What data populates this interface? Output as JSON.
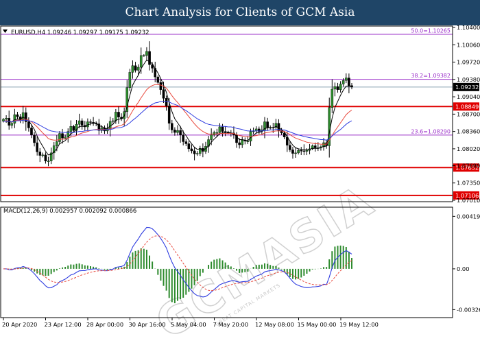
{
  "banner": {
    "title": "Chart Analysis for Clients of GCM Asia"
  },
  "watermark": {
    "text": "GCMASIA",
    "sub": "GREAT CAPITAL MARKETS"
  },
  "chart_data": {
    "type": "candlestick",
    "symbol_info": "EURUSD,H4  1.09246 1.09297 1.09175 1.09232",
    "price_axis": {
      "ylim": [
        1.0701,
        1.104
      ],
      "ticks": [
        "1.10400",
        "1.10060",
        "1.09720",
        "1.09380",
        "1.09040",
        "1.08700",
        "1.08360",
        "1.08020",
        "1.07690",
        "1.07350",
        "1.07010"
      ],
      "tick_values": [
        1.104,
        1.1006,
        1.0972,
        1.0938,
        1.0904,
        1.087,
        1.0836,
        1.0802,
        1.0769,
        1.0735,
        1.0701
      ]
    },
    "current_price": {
      "label": "1.09232",
      "value": 1.09232,
      "color": "#000000"
    },
    "fib_levels": [
      {
        "label": "50.0=1.10265",
        "value": 1.10265
      },
      {
        "label": "38.2=1.09382",
        "value": 1.09382
      },
      {
        "label": "23.6=1.08290",
        "value": 1.0829
      }
    ],
    "sr_levels": [
      {
        "label": "1.08849",
        "value": 1.08849
      },
      {
        "label": "1.07652",
        "value": 1.07652
      },
      {
        "label": "1.07106",
        "value": 1.07106
      }
    ],
    "x_labels": [
      "20 Apr 2020",
      "23 Apr 12:00",
      "28 Apr 00:00",
      "30 Apr 16:00",
      "5 May 04:00",
      "7 May 20:00",
      "12 May 08:00",
      "15 May 00:00",
      "19 May 12:00"
    ],
    "close_prices": [
      1.086,
      1.0862,
      1.0848,
      1.0852,
      1.0869,
      1.0865,
      1.0859,
      1.0873,
      1.0855,
      1.0843,
      1.0829,
      1.0814,
      1.0796,
      1.0789,
      1.079,
      1.0778,
      1.0778,
      1.0794,
      1.0808,
      1.0816,
      1.0832,
      1.0823,
      1.0825,
      1.0836,
      1.0846,
      1.0838,
      1.085,
      1.0857,
      1.0848,
      1.0845,
      1.0855,
      1.0854,
      1.0853,
      1.0851,
      1.0838,
      1.0843,
      1.0837,
      1.0842,
      1.0856,
      1.0857,
      1.0874,
      1.0864,
      1.0861,
      1.0875,
      1.0922,
      1.0952,
      1.0965,
      1.0956,
      1.0962,
      1.0985,
      1.0985,
      1.0993,
      1.0967,
      1.096,
      1.0943,
      1.0932,
      1.0918,
      1.0901,
      1.0886,
      1.0852,
      1.0839,
      1.0834,
      1.0838,
      1.0829,
      1.0816,
      1.0812,
      1.0802,
      1.0798,
      1.0792,
      1.0793,
      1.0803,
      1.0797,
      1.0807,
      1.082,
      1.0829,
      1.0834,
      1.0834,
      1.0845,
      1.0836,
      1.0835,
      1.0833,
      1.0833,
      1.0829,
      1.0814,
      1.081,
      1.0819,
      1.0817,
      1.0817,
      1.0836,
      1.0837,
      1.0841,
      1.0836,
      1.0839,
      1.0855,
      1.0844,
      1.0844,
      1.0844,
      1.0852,
      1.0838,
      1.0833,
      1.0825,
      1.0809,
      1.08,
      1.0793,
      1.0794,
      1.0799,
      1.0798,
      1.0797,
      1.0799,
      1.0802,
      1.0808,
      1.0804,
      1.0804,
      1.0806,
      1.0814,
      1.0808,
      1.0883,
      1.0919,
      1.0924,
      1.0918,
      1.0929,
      1.0936,
      1.0941,
      1.0926,
      1.0923
    ],
    "indicators": [
      {
        "name": "fast_ma",
        "color": "#000000",
        "values": [
          1.0856,
          1.0857,
          1.0854,
          1.0855,
          1.0859,
          1.086,
          1.086,
          1.0864,
          1.0861,
          1.0857,
          1.0849,
          1.084,
          1.0827,
          1.0816,
          1.0807,
          1.0797,
          1.079,
          1.0791,
          1.0796,
          1.0802,
          1.0812,
          1.0815,
          1.0818,
          1.0824,
          1.0832,
          1.0834,
          1.084,
          1.0846,
          1.0846,
          1.0846,
          1.0849,
          1.0851,
          1.0852,
          1.0852,
          1.0847,
          1.0846,
          1.0842,
          1.0842,
          1.0847,
          1.085,
          1.0858,
          1.086,
          1.0861,
          1.0866,
          1.0885,
          1.0907,
          1.0927,
          1.0937,
          1.0946,
          1.0959,
          1.0968,
          1.0976,
          1.0973,
          1.0969,
          1.096,
          1.0951,
          1.094,
          1.0927,
          1.0913,
          1.0893,
          1.0875,
          1.0861,
          1.0853,
          1.0845,
          1.0835,
          1.0828,
          1.0819,
          1.0812,
          1.0805,
          1.0801,
          1.0802,
          1.08,
          1.0802,
          1.0808,
          1.0815,
          1.0821,
          1.0826,
          1.0832,
          1.0833,
          1.0834,
          1.0834,
          1.0833,
          1.0832,
          1.0826,
          1.082,
          1.082,
          1.0819,
          1.0818,
          1.0824,
          1.0828,
          1.0833,
          1.0834,
          1.0836,
          1.0842,
          1.0843,
          1.0843,
          1.0843,
          1.0846,
          1.0843,
          1.084,
          1.0835,
          1.0826,
          1.0817,
          1.0809,
          1.0804,
          1.0802,
          1.0801,
          1.08,
          1.08,
          1.0801,
          1.0803,
          1.0803,
          1.0803,
          1.0804,
          1.0807,
          1.0807,
          1.0833,
          1.0862,
          1.0883,
          1.0895,
          1.0907,
          1.0917,
          1.0925,
          1.0925,
          1.0924
        ]
      },
      {
        "name": "mid_ma",
        "color": "#e8473b",
        "values": [
          1.0856,
          1.0857,
          1.0856,
          1.0855,
          1.0857,
          1.0858,
          1.0858,
          1.086,
          1.086,
          1.0858,
          1.0855,
          1.085,
          1.0845,
          1.0839,
          1.0833,
          1.0828,
          1.0822,
          1.082,
          1.0819,
          1.0819,
          1.082,
          1.0821,
          1.0821,
          1.0823,
          1.0825,
          1.0826,
          1.0828,
          1.0831,
          1.0833,
          1.0834,
          1.0836,
          1.0838,
          1.0839,
          1.084,
          1.084,
          1.084,
          1.084,
          1.084,
          1.0841,
          1.0843,
          1.0845,
          1.0847,
          1.0848,
          1.0851,
          1.0858,
          1.0867,
          1.0877,
          1.0885,
          1.0893,
          1.0902,
          1.091,
          1.0918,
          1.0923,
          1.0926,
          1.0928,
          1.0928,
          1.0927,
          1.0925,
          1.0921,
          1.0914,
          1.0906,
          1.0899,
          1.0893,
          1.0886,
          1.0879,
          1.0872,
          1.0865,
          1.0858,
          1.0851,
          1.0845,
          1.084,
          1.0836,
          1.0833,
          1.0831,
          1.0831,
          1.0831,
          1.0831,
          1.0832,
          1.0832,
          1.0832,
          1.0832,
          1.0832,
          1.0832,
          1.083,
          1.0828,
          1.0827,
          1.0826,
          1.0825,
          1.0826,
          1.0827,
          1.0828,
          1.0829,
          1.083,
          1.0833,
          1.0834,
          1.0835,
          1.0836,
          1.0837,
          1.0837,
          1.0837,
          1.0836,
          1.0833,
          1.083,
          1.0826,
          1.0823,
          1.0821,
          1.0819,
          1.0817,
          1.0815,
          1.0814,
          1.0813,
          1.0812,
          1.0812,
          1.0811,
          1.0811,
          1.0811,
          1.0818,
          1.0828,
          1.0837,
          1.0845,
          1.0853,
          1.0861,
          1.0869,
          1.0874,
          1.0878
        ]
      },
      {
        "name": "slow_ma",
        "color": "#2e3ce0",
        "values": [
          1.0856,
          1.0856,
          1.0856,
          1.0855,
          1.0856,
          1.0857,
          1.0857,
          1.0858,
          1.0858,
          1.0857,
          1.0856,
          1.0854,
          1.0851,
          1.0848,
          1.0845,
          1.0842,
          1.0839,
          1.0837,
          1.0836,
          1.0835,
          1.0835,
          1.0834,
          1.0834,
          1.0834,
          1.0834,
          1.0834,
          1.0835,
          1.0836,
          1.0836,
          1.0837,
          1.0838,
          1.0838,
          1.0839,
          1.0839,
          1.0839,
          1.0839,
          1.0839,
          1.084,
          1.084,
          1.0841,
          1.0843,
          1.0843,
          1.0844,
          1.0846,
          1.0849,
          1.0853,
          1.0858,
          1.0862,
          1.0867,
          1.0872,
          1.0877,
          1.0882,
          1.0886,
          1.0889,
          1.0892,
          1.0893,
          1.0895,
          1.0895,
          1.0895,
          1.0894,
          1.0891,
          1.0889,
          1.0887,
          1.0884,
          1.088,
          1.0877,
          1.0873,
          1.0869,
          1.0865,
          1.0861,
          1.0858,
          1.0855,
          1.0852,
          1.085,
          1.0849,
          1.0848,
          1.0847,
          1.0847,
          1.0846,
          1.0846,
          1.0845,
          1.0845,
          1.0844,
          1.0842,
          1.0841,
          1.084,
          1.0838,
          1.0837,
          1.0837,
          1.0837,
          1.0837,
          1.0837,
          1.0837,
          1.0838,
          1.0838,
          1.0839,
          1.0839,
          1.084,
          1.084,
          1.0839,
          1.0839,
          1.0837,
          1.0835,
          1.0833,
          1.0831,
          1.0829,
          1.0828,
          1.0826,
          1.0825,
          1.0824,
          1.0823,
          1.0822,
          1.0821,
          1.082,
          1.082,
          1.0819,
          1.0822,
          1.0827,
          1.0832,
          1.0836,
          1.084,
          1.0845,
          1.085,
          1.0854,
          1.0857
        ]
      }
    ],
    "macd": {
      "label": "MACD(12,26,9) 0.002957 0.002092 0.000866",
      "ticks": [
        "0.004197",
        "0.00",
        "-0.003262"
      ],
      "tick_values": [
        0.004197,
        0,
        -0.003262
      ],
      "ylim": [
        -0.00335,
        0.0046
      ],
      "histogram_color": "#2e8b2e",
      "signal_color": "#e8473b",
      "line_color": "#2e3ce0",
      "histogram": [
        0,
        1e-05,
        1e-05,
        1e-05,
        4e-05,
        6e-05,
        6e-05,
        0.0001,
        5e-05,
        -1e-05,
        -0.0001,
        -0.00022,
        -0.00037,
        -0.00048,
        -0.00052,
        -0.00057,
        -0.00055,
        -0.00041,
        -0.00025,
        -0.00013,
        4e-05,
        0.00011,
        0.00016,
        0.00026,
        0.00035,
        0.00034,
        0.0004,
        0.00043,
        0.00036,
        0.00028,
        0.00026,
        0.00021,
        0.00017,
        0.00012,
        3e-05,
        -1e-05,
        -7e-05,
        -9e-05,
        -4e-05,
        -1e-05,
        9e-05,
        0.00011,
        0.00011,
        0.00017,
        0.00054,
        0.00097,
        0.00131,
        0.00143,
        0.00149,
        0.00164,
        0.0016,
        0.00153,
        0.00106,
        0.00058,
        2e-05,
        -0.00048,
        -0.00094,
        -0.00136,
        -0.00174,
        -0.00233,
        -0.00266,
        -0.00275,
        -0.00256,
        -0.00242,
        -0.00231,
        -0.00207,
        -0.00184,
        -0.00158,
        -0.00131,
        -0.00097,
        -0.00058,
        -0.00031,
        0,
        0.00032,
        0.00057,
        0.00073,
        0.00078,
        0.00084,
        0.00068,
        0.00051,
        0.00032,
        0.00019,
        4e-05,
        -0.00015,
        -0.00033,
        -0.0003,
        -0.00027,
        -0.00022,
        1e-05,
        0.00016,
        0.00031,
        0.00033,
        0.00034,
        0.00044,
        0.0004,
        0.00031,
        0.00023,
        0.00022,
        0.0001,
        -5e-05,
        -0.00023,
        -0.00046,
        -0.00066,
        -0.00081,
        -0.00085,
        -0.0008,
        -0.00069,
        -0.00055,
        -0.00039,
        -0.00021,
        -5e-05,
        -3e-05,
        -1e-05,
        3e-05,
        0.00014,
        0.00015,
        0.00076,
        0.00141,
        0.00178,
        0.00184,
        0.00186,
        0.00183,
        0.00175,
        0.00137,
        0.00087
      ],
      "macd_line": [
        0,
        0,
        -7e-05,
        -8e-05,
        3e-05,
        8e-05,
        0.0001,
        0.00019,
        0.00012,
        1e-05,
        -0.00017,
        -0.00039,
        -0.00066,
        -0.00093,
        -0.00112,
        -0.00136,
        -0.00152,
        -0.00151,
        -0.00139,
        -0.00127,
        -0.00103,
        -0.00093,
        -0.00082,
        -0.00066,
        -0.00048,
        -0.00042,
        -0.00028,
        -0.00016,
        -0.00014,
        -0.00014,
        -7e-05,
        -4e-05,
        -1e-05,
        0,
        -8e-05,
        -0.0001,
        -0.00015,
        -0.00015,
        -7e-05,
        -2e-05,
        0.00012,
        0.00016,
        0.00019,
        0.00028,
        0.00069,
        0.00123,
        0.00175,
        0.00208,
        0.00238,
        0.00276,
        0.00304,
        0.00331,
        0.0033,
        0.0032,
        0.00298,
        0.00273,
        0.00243,
        0.00208,
        0.00168,
        0.00107,
        0.00054,
        9e-05,
        -0.00021,
        -0.00052,
        -0.00087,
        -0.00117,
        -0.00148,
        -0.00175,
        -0.00199,
        -0.00214,
        -0.00218,
        -0.00225,
        -0.00221,
        -0.00206,
        -0.00185,
        -0.00165,
        -0.00147,
        -0.00127,
        -0.00118,
        -0.0011,
        -0.00103,
        -0.00097,
        -0.00094,
        -0.00101,
        -0.00107,
        -0.00103,
        -0.00101,
        -0.001,
        -0.00085,
        -0.00072,
        -0.00058,
        -0.0005,
        -0.00041,
        -0.00024,
        -0.00018,
        -0.00014,
        -0.0001,
        -4e-05,
        -8e-05,
        -0.00014,
        -0.00025,
        -0.00047,
        -0.00075,
        -0.00102,
        -0.00122,
        -0.00132,
        -0.00141,
        -0.00147,
        -0.0015,
        -0.00149,
        -0.00144,
        -0.00143,
        -0.00141,
        -0.00136,
        -0.00123,
        -0.00126,
        -0.00066,
        9e-05,
        0.00066,
        0.00092,
        0.00114,
        0.00132,
        0.00146,
        0.00133,
        0.00118
      ],
      "signal_line": [
        0,
        0,
        -1e-05,
        -3e-05,
        -1e-05,
        1e-05,
        3e-05,
        6e-05,
        8e-05,
        7e-05,
        2e-05,
        -7e-05,
        -0.00019,
        -0.00034,
        -0.0005,
        -0.00067,
        -0.00084,
        -0.00097,
        -0.00105,
        -0.00109,
        -0.00108,
        -0.00105,
        -0.00101,
        -0.00094,
        -0.00085,
        -0.00076,
        -0.00067,
        -0.00057,
        -0.00048,
        -0.00041,
        -0.00034,
        -0.00028,
        -0.00023,
        -0.00018,
        -0.00016,
        -0.00015,
        -0.00015,
        -0.00015,
        -0.00013,
        -0.00011,
        -6e-05,
        -2e-05,
        2e-05,
        7e-05,
        0.00019,
        0.00039,
        0.00066,
        0.00094,
        0.00123,
        0.00154,
        0.00184,
        0.00213,
        0.00236,
        0.00253,
        0.00262,
        0.00264,
        0.0026,
        0.0025,
        0.00233,
        0.00208,
        0.00178,
        0.00144,
        0.00111,
        0.00078,
        0.00045,
        0.00012,
        -0.0002,
        -0.00051,
        -0.00081,
        -0.00107,
        -0.00129,
        -0.00148,
        -0.00163,
        -0.00172,
        -0.00174,
        -0.00172,
        -0.00167,
        -0.00159,
        -0.0015,
        -0.00142,
        -0.00134,
        -0.00127,
        -0.0012,
        -0.00116,
        -0.00114,
        -0.00112,
        -0.0011,
        -0.00108,
        -0.00103,
        -0.00097,
        -0.0009,
        -0.00082,
        -0.00074,
        -0.00064,
        -0.00055,
        -0.00047,
        -0.0004,
        -0.00032,
        -0.00027,
        -0.00024,
        -0.00024,
        -0.00029,
        -0.00038,
        -0.00051,
        -0.00065,
        -0.00078,
        -0.0009,
        -0.00102,
        -0.00111,
        -0.00119,
        -0.00124,
        -0.00127,
        -0.00128,
        -0.00128,
        -0.00128,
        -0.00126,
        -0.00116,
        -0.00093,
        -0.00066,
        -0.00039,
        -0.00015,
        8e-05,
        0.00032,
        0.00052,
        0.00067
      ]
    }
  }
}
